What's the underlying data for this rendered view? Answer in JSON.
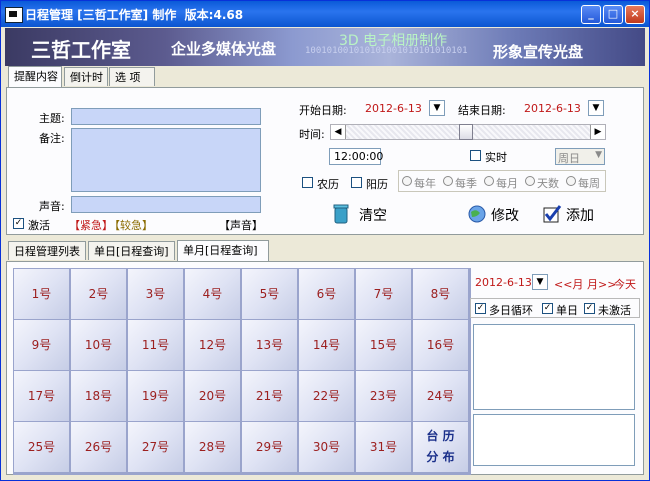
{
  "window": {
    "title": "日程管理 [三哲工作室] 制作  版本:4.68",
    "buttons": {
      "minimize": "_",
      "maximize": "□",
      "close": "×"
    }
  },
  "banner": {
    "studio": "三哲工作室",
    "slogan1": "企业多媒体光盘",
    "slogan2": "3D 电子相册制作",
    "binary": "100101001010101001010101010101",
    "slogan3": "形象宣传光盘"
  },
  "tabs_top": [
    "提醒内容",
    "倒计时",
    "选 项"
  ],
  "form": {
    "subject_label": "主题:",
    "note_label": "备注:",
    "sound_label": "声音:",
    "activate_label": "激活",
    "urgent": "【紧急】",
    "less_urgent": "【较急】",
    "sound_tag": "【声音】",
    "start_label": "开始日期:",
    "start_value": "2012-6-13",
    "end_label": "结束日期:",
    "end_value": "2012-6-13",
    "time_label": "时间:",
    "slider_position": 0.49,
    "time_value": "12:00:00",
    "realtime_label": "实时",
    "period_value": "周日",
    "lunar_label": "农历",
    "solar_label": "阳历",
    "freq_options": [
      "每年",
      "每季",
      "每月",
      "天数",
      "每周"
    ],
    "clear_button": "清空",
    "modify_button": "修改",
    "add_button": "添加"
  },
  "tabs_bottom": [
    "日程管理列表",
    "单日[日程查询]",
    "单月[日程查询]"
  ],
  "calendar": {
    "days": [
      "1号",
      "2号",
      "3号",
      "4号",
      "5号",
      "6号",
      "7号",
      "8号",
      "9号",
      "10号",
      "11号",
      "12号",
      "13号",
      "14号",
      "15号",
      "16号",
      "17号",
      "18号",
      "19号",
      "20号",
      "21号",
      "22号",
      "23号",
      "24号",
      "25号",
      "26号",
      "27号",
      "28号",
      "29号",
      "30号",
      "31号"
    ],
    "extra_line1": "台 历",
    "extra_line2": "分 布"
  },
  "right_panel": {
    "date_value": "2012-6-13",
    "prev_month": "<<月",
    "next_month": "月>>",
    "today": "今天",
    "option1": "多日循环",
    "option2": "单日",
    "option3": "未激活"
  },
  "colors": {
    "titlebar": "#0a5ad8",
    "date_text": "#c01818",
    "calendar_text": "#9c2020",
    "nav_text": "#c01818"
  }
}
